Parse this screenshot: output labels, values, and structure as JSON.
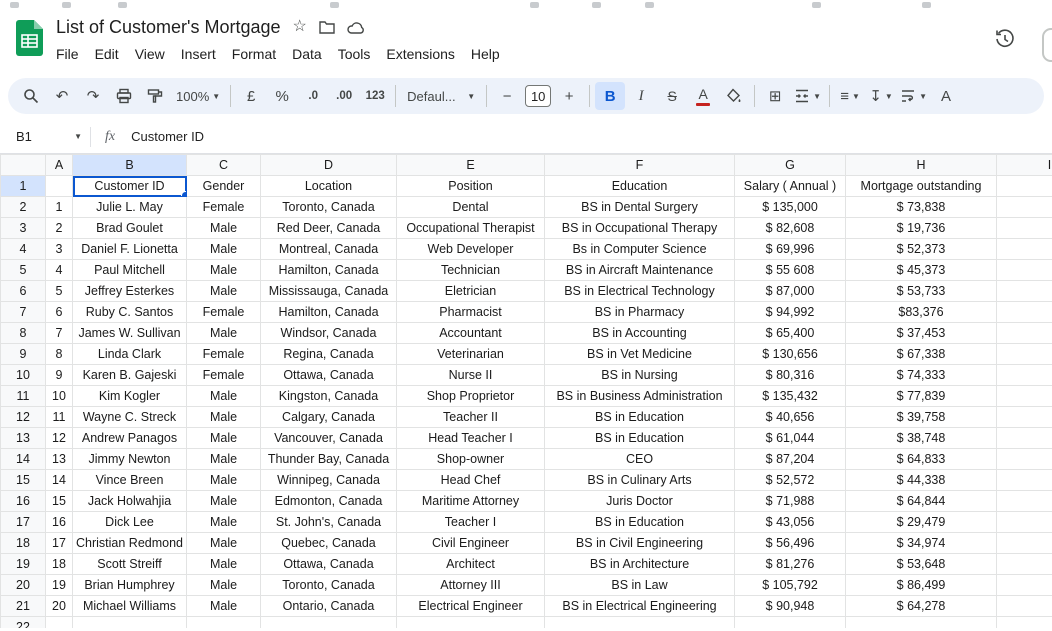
{
  "header": {
    "title": "List of Customer's Mortgage",
    "menus": [
      "File",
      "Edit",
      "View",
      "Insert",
      "Format",
      "Data",
      "Tools",
      "Extensions",
      "Help"
    ]
  },
  "toolbar": {
    "undo_glyph": "↶",
    "redo_glyph": "↷",
    "zoom": "100%",
    "currency": "£",
    "percent": "%",
    "decrease_decimal": ".0",
    "increase_decimal": ".00",
    "number_format": "123",
    "font_name": "Defaul...",
    "decrease_font": "−",
    "font_size": "10",
    "increase_font": "+",
    "bold": "B",
    "italic": "I",
    "strikethrough": "S",
    "text_color": "A",
    "borders_glyph": "⊞",
    "align_glyph": "≡",
    "valign_glyph": "↧",
    "rotate_glyph": "A"
  },
  "formula_bar": {
    "cell_ref": "B1",
    "fx": "fx",
    "value": "Customer ID"
  },
  "grid": {
    "column_letters": [
      "A",
      "B",
      "C",
      "D",
      "E",
      "F",
      "G",
      "H",
      "I"
    ],
    "selected": {
      "cell": "B1",
      "column": "B",
      "row": 1
    },
    "header_row": [
      "Customer ID",
      "Gender",
      "Location",
      "Position",
      "Education",
      "Salary ( Annual )",
      "Mortgage outstanding"
    ],
    "rows": [
      [
        "1",
        "Julie L. May",
        "Female",
        "Toronto, Canada",
        "Dental",
        "BS in Dental Surgery",
        "$ 135,000",
        "$ 73,838"
      ],
      [
        "2",
        "Brad Goulet",
        "Male",
        "Red Deer, Canada",
        "Occupational Therapist",
        "BS in Occupational Therapy",
        "$ 82,608",
        "$ 19,736"
      ],
      [
        "3",
        "Daniel F. Lionetta",
        "Male",
        "Montreal, Canada",
        "Web Developer",
        "Bs in Computer Science",
        "$ 69,996",
        "$ 52,373"
      ],
      [
        "4",
        "Paul Mitchell",
        "Male",
        "Hamilton, Canada",
        "Technician",
        "BS in Aircraft Maintenance",
        "$ 55 608",
        "$ 45,373"
      ],
      [
        "5",
        "Jeffrey Esterkes",
        "Male",
        "Mississauga, Canada",
        "Eletrician",
        "BS in Electrical Technology",
        "$ 87,000",
        "$ 53,733"
      ],
      [
        "6",
        "Ruby C. Santos",
        "Female",
        "Hamilton, Canada",
        "Pharmacist",
        "BS in Pharmacy",
        "$ 94,992",
        "$83,376"
      ],
      [
        "7",
        "James W. Sullivan",
        "Male",
        "Windsor, Canada",
        "Accountant",
        "BS in Accounting",
        "$ 65,400",
        "$ 37,453"
      ],
      [
        "8",
        "Linda Clark",
        "Female",
        "Regina, Canada",
        "Veterinarian",
        "BS in Vet Medicine",
        "$ 130,656",
        "$ 67,338"
      ],
      [
        "9",
        "Karen B. Gajeski",
        "Female",
        "Ottawa, Canada",
        "Nurse II",
        "BS in Nursing",
        "$ 80,316",
        "$ 74,333"
      ],
      [
        "10",
        "Kim Kogler",
        "Male",
        "Kingston, Canada",
        "Shop Proprietor",
        "BS in Business Administration",
        "$ 135,432",
        "$ 77,839"
      ],
      [
        "11",
        "Wayne C. Streck",
        "Male",
        "Calgary, Canada",
        "Teacher II",
        "BS in Education",
        "$ 40,656",
        "$ 39,758"
      ],
      [
        "12",
        "Andrew Panagos",
        "Male",
        "Vancouver, Canada",
        "Head Teacher I",
        "BS in Education",
        "$ 61,044",
        "$ 38,748"
      ],
      [
        "13",
        "Jimmy Newton",
        "Male",
        "Thunder Bay, Canada",
        "Shop-owner",
        "CEO",
        "$ 87,204",
        "$ 64,833"
      ],
      [
        "14",
        "Vince Breen",
        "Male",
        "Winnipeg, Canada",
        "Head Chef",
        "BS in Culinary Arts",
        "$ 52,572",
        "$ 44,338"
      ],
      [
        "15",
        "Jack Holwahjia",
        "Male",
        "Edmonton, Canada",
        "Maritime Attorney",
        "Juris Doctor",
        "$ 71,988",
        "$ 64,844"
      ],
      [
        "16",
        "Dick Lee",
        "Male",
        "St. John's, Canada",
        "Teacher I",
        "BS in Education",
        "$ 43,056",
        "$ 29,479"
      ],
      [
        "17",
        "Christian Redmond",
        "Male",
        "Quebec, Canada",
        "Civil Engineer",
        "BS in Civil Engineering",
        "$ 56,496",
        "$ 34,974"
      ],
      [
        "18",
        "Scott Streiff",
        "Male",
        "Ottawa, Canada",
        "Architect",
        "BS in Architecture",
        "$ 81,276",
        "$ 53,648"
      ],
      [
        "19",
        "Brian Humphrey",
        "Male",
        "Toronto, Canada",
        "Attorney III",
        "BS in Law",
        "$ 105,792",
        "$ 86,499"
      ],
      [
        "20",
        "Michael Williams",
        "Male",
        "Ontario, Canada",
        "Electrical Engineer",
        "BS in Electrical Engineering",
        "$ 90,948",
        "$ 64,278"
      ]
    ]
  },
  "colors": {
    "accent": "#0b57d0",
    "header_highlight": "#d3e3fd",
    "toolbar_bg": "#edf2fa",
    "text_color_underline": "#c5221f",
    "logo_green": "#0f9d58"
  }
}
